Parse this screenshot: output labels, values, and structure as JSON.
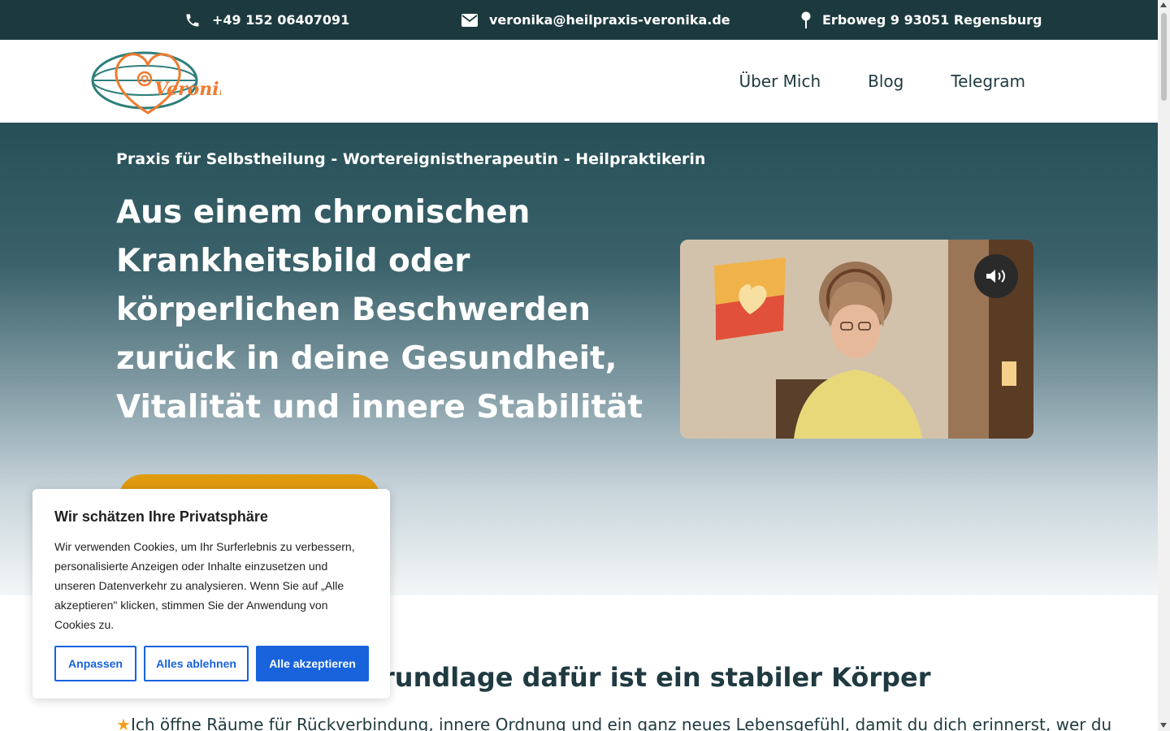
{
  "topbar": {
    "phone": "+49 152 06407091",
    "email": "veronika@heilpraxis-veronika.de",
    "address": "Erboweg 9 93051 Regensburg",
    "phone_icon": "phone-icon",
    "email_icon": "envelope-icon",
    "address_icon": "map-pin-icon"
  },
  "header": {
    "logo_text": "Veronika",
    "nav": [
      {
        "label": "Über Mich"
      },
      {
        "label": "Blog"
      },
      {
        "label": "Telegram"
      }
    ]
  },
  "hero": {
    "subtitle": "Praxis für Selbstheilung - Wortereignistherapeutin - Heilpraktikerin",
    "title": "Aus einem chronischen Krankheitsbild oder körperlichen Beschwerden zurück in deine Gesundheit, Vitalität und innere Stabilität",
    "video_sound_icon": "speaker-volume-icon"
  },
  "section": {
    "heading": "rundlage dafür ist ein stabiler Körper",
    "text": "Ich öffne Räume für Rückverbindung, innere Ordnung und ein ganz neues Lebensgefühl, damit du dich erinnerst, wer du"
  },
  "cookie": {
    "title": "Wir schätzen Ihre Privatsphäre",
    "text": "Wir verwenden Cookies, um Ihr Surferlebnis zu verbessern, personalisierte Anzeigen oder Inhalte einzusetzen und unseren Datenverkehr zu analysieren. Wenn Sie auf „Alle akzeptieren\" klicken, stimmen Sie der Anwendung von Cookies zu.",
    "customize": "Anpassen",
    "reject": "Alles ablehnen",
    "accept": "Alle akzeptieren"
  },
  "colors": {
    "topbar": "#1c3a3e",
    "cta": "#e09a10",
    "cookie_accent": "#1863dc",
    "logo_orange": "#f07a2e",
    "logo_teal": "#2e7f7a"
  }
}
